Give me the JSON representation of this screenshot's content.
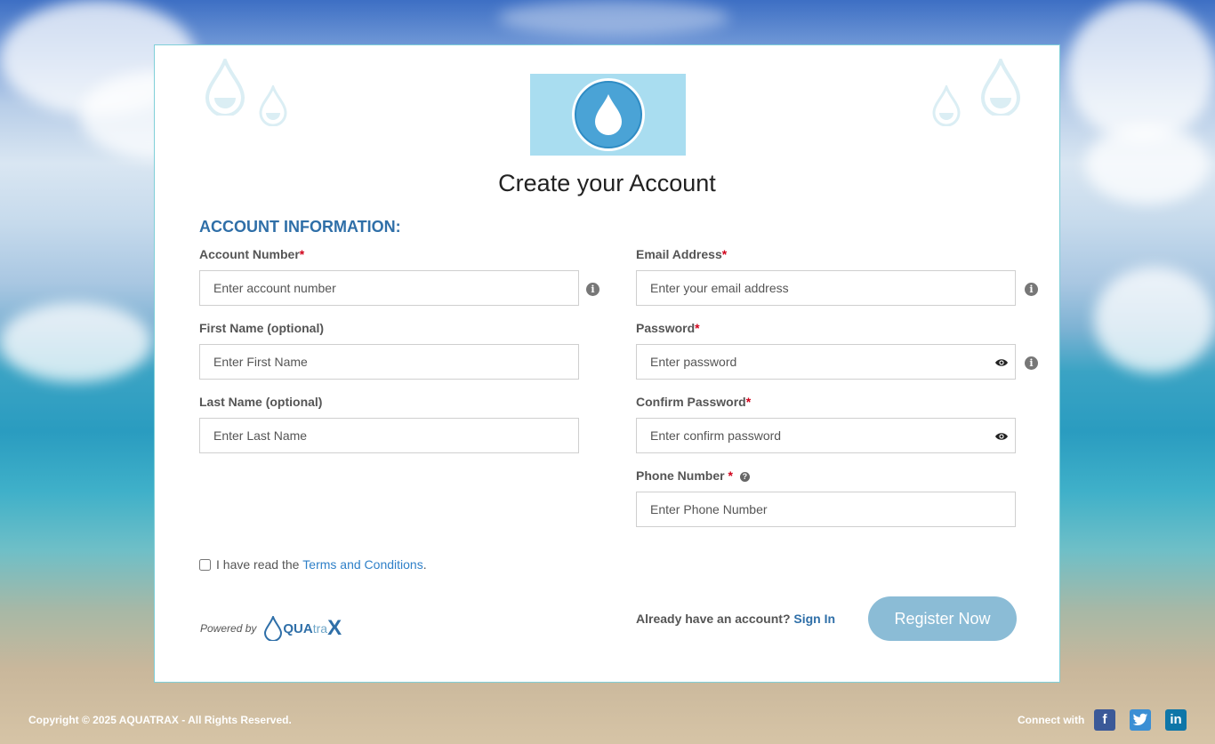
{
  "header": {
    "title": "Create your Account",
    "section_title": "ACCOUNT INFORMATION:"
  },
  "fields": {
    "account_number": {
      "label": "Account Number",
      "required_mark": "*",
      "placeholder": "Enter account number",
      "value": ""
    },
    "first_name": {
      "label": "First Name (optional)",
      "placeholder": "Enter First Name",
      "value": ""
    },
    "last_name": {
      "label": "Last Name (optional)",
      "placeholder": "Enter Last Name",
      "value": ""
    },
    "email": {
      "label": "Email Address",
      "required_mark": "*",
      "placeholder": "Enter your email address",
      "value": ""
    },
    "password": {
      "label": "Password",
      "required_mark": "*",
      "placeholder": "Enter password",
      "value": ""
    },
    "confirm_password": {
      "label": "Confirm Password",
      "required_mark": "*",
      "placeholder": "Enter confirm password",
      "value": ""
    },
    "phone": {
      "label": "Phone Number",
      "required_mark": "*",
      "placeholder": "Enter Phone Number",
      "value": ""
    }
  },
  "terms": {
    "prefix": "I have read the",
    "link": "Terms and Conditions",
    "suffix": "."
  },
  "footer_card": {
    "powered_by": "Powered by",
    "brand_prefix": "QUA",
    "brand_suffix": "tra",
    "brand_x": "X",
    "already_text": "Already have an account?",
    "sign_in": "Sign In",
    "register_button": "Register Now"
  },
  "page_footer": {
    "copyright": "Copyright © 2025 AQUATRAX - All Rights Reserved.",
    "connect": "Connect with",
    "social": [
      "facebook-icon",
      "twitter-icon",
      "linkedin-icon"
    ]
  },
  "colors": {
    "accent": "#2f6fa8",
    "button": "#8bbcd6",
    "required": "#d0021b",
    "logo_bg": "#a9ddf0"
  }
}
